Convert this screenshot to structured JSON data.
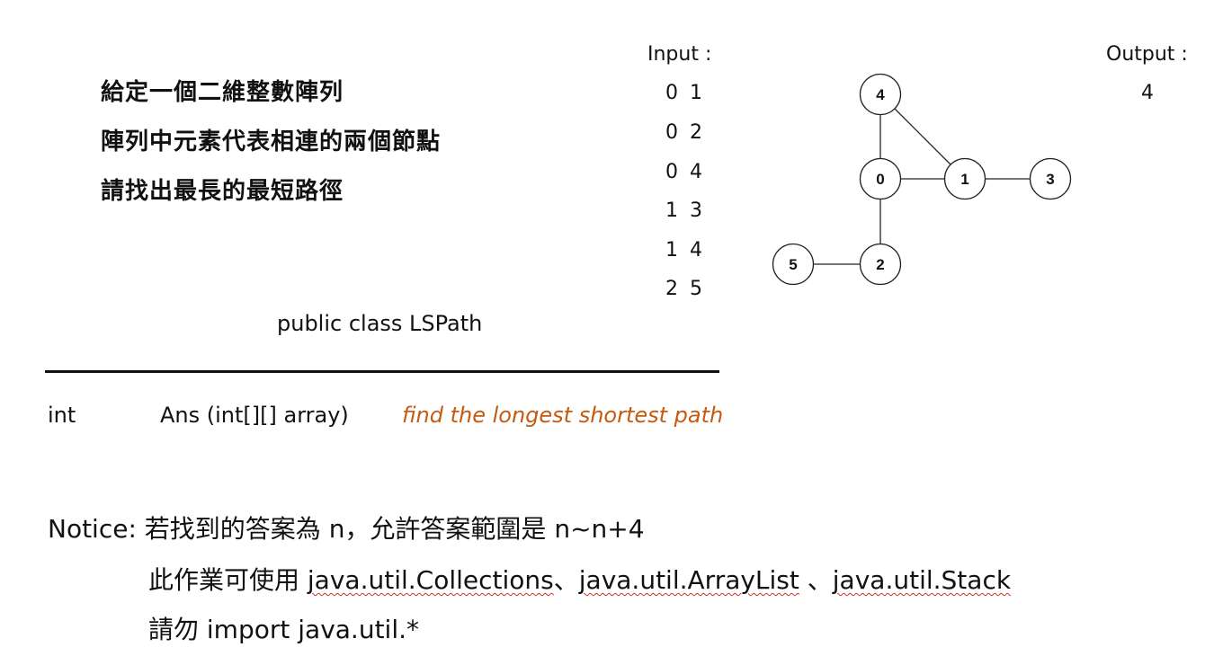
{
  "description": {
    "line1": "給定一個二維整數陣列",
    "line2": "陣列中元素代表相連的兩個節點",
    "line3": "請找出最長的最短路徑"
  },
  "input": {
    "label": "Input :",
    "rows": [
      "0 1",
      "0 2",
      "0 4",
      "1 3",
      "1 4",
      "2 5"
    ]
  },
  "output": {
    "label": "Output :",
    "value": "4"
  },
  "graph": {
    "nodes": [
      "4",
      "0",
      "1",
      "3",
      "5",
      "2"
    ],
    "edges": [
      [
        "4",
        "0"
      ],
      [
        "4",
        "1"
      ],
      [
        "0",
        "1"
      ],
      [
        "1",
        "3"
      ],
      [
        "0",
        "2"
      ],
      [
        "5",
        "2"
      ]
    ]
  },
  "class_title": "public class LSPath",
  "method": {
    "return_type": "int",
    "signature": "Ans (int[][]  array)",
    "description": "find the longest shortest path",
    "description_color": "#c55a11"
  },
  "notice": {
    "line1": "Notice: 若找到的答案為 n，允許答案範圍是 n~n+4",
    "line2_prefix": "此作業可使用 ",
    "lib1": "java.util.Collections",
    "sep1": "、",
    "lib2": "java.util.ArrayList",
    "sep2": " 、",
    "lib3": "java.util.Stack",
    "line3": "請勿 import java.util.*"
  }
}
